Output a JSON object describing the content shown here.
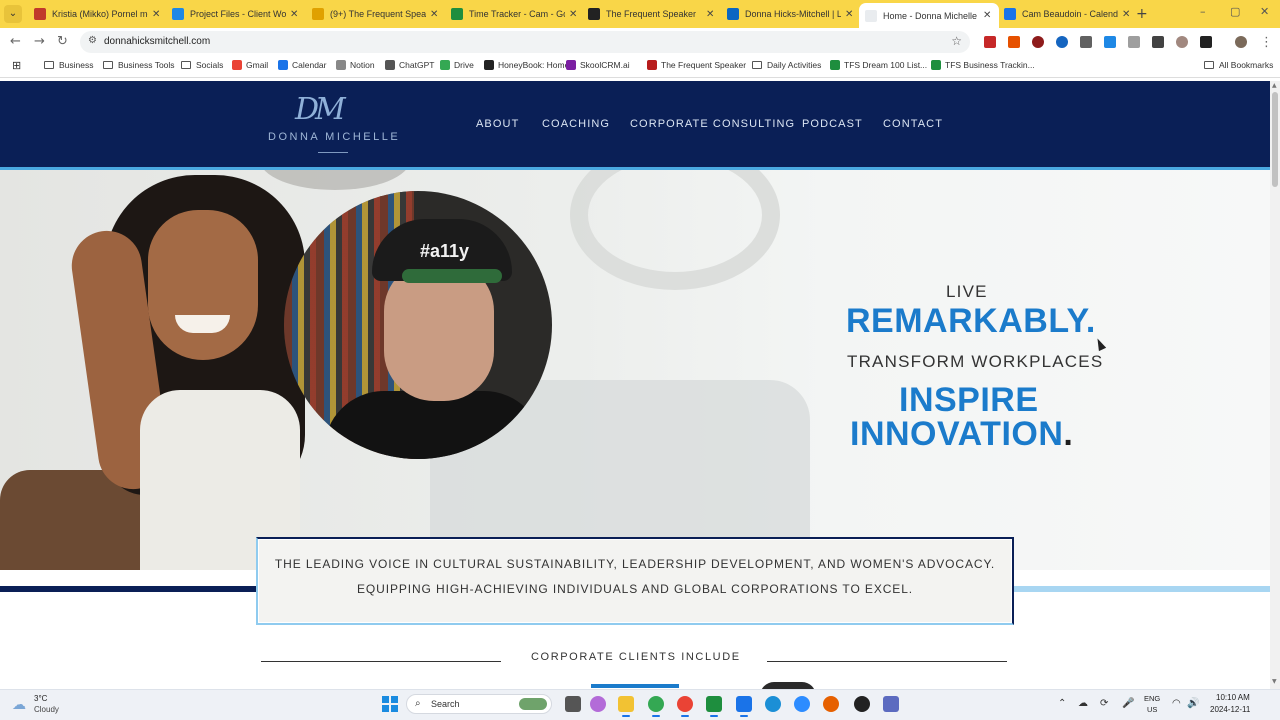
{
  "browser": {
    "tabs": [
      {
        "title": "Kristia (Mikko) Pornel me",
        "color": "#c0392b",
        "active": false
      },
      {
        "title": "Project Files - Client Work",
        "color": "#1e88e5",
        "active": false
      },
      {
        "title": "(9+) The Frequent Speaker",
        "color": "#e0a100",
        "active": false
      },
      {
        "title": "Time Tracker - Cam - Goo",
        "color": "#1e8e3e",
        "active": false
      },
      {
        "title": "The Frequent Speaker",
        "color": "#222222",
        "active": false
      },
      {
        "title": "Donna Hicks-Mitchell | Li",
        "color": "#0a66c2",
        "active": false
      },
      {
        "title": "Home - Donna Michelle",
        "color": "#ffffff",
        "active": true
      },
      {
        "title": "Cam Beaudoin - Calendar",
        "color": "#1a73e8",
        "active": false
      }
    ],
    "url": "donnahicksmitchell.com",
    "bookmarks": [
      {
        "label": "Business",
        "type": "folder"
      },
      {
        "label": "Business Tools",
        "type": "folder"
      },
      {
        "label": "Socials",
        "type": "folder"
      },
      {
        "label": "Gmail",
        "type": "gmail"
      },
      {
        "label": "Calendar",
        "type": "calendar"
      },
      {
        "label": "Notion",
        "type": "notion"
      },
      {
        "label": "ChatGPT",
        "type": "chatgpt"
      },
      {
        "label": "Drive",
        "type": "drive"
      },
      {
        "label": "HoneyBook: Home",
        "type": "honeybook"
      },
      {
        "label": "SkoolCRM.ai",
        "type": "skool"
      },
      {
        "label": "The Frequent Speaker",
        "type": "frequent"
      },
      {
        "label": "Daily Activities",
        "type": "folder"
      },
      {
        "label": "TFS Dream 100 List...",
        "type": "sheets"
      },
      {
        "label": "TFS Business Trackin...",
        "type": "sheets"
      }
    ],
    "all_bookmarks": "All Bookmarks"
  },
  "site": {
    "logo_mark": "DM",
    "logo_text": "DONNA MICHELLE",
    "nav": [
      "ABOUT",
      "COACHING",
      "CORPORATE CONSULTING",
      "PODCAST",
      "CONTACT"
    ],
    "avatar_cap_text": "#a11y",
    "tagline": {
      "live": "LIVE",
      "remarkably": "REMARKABLY",
      "transform": "TRANSFORM WORKPLACES",
      "inspire": "INSPIRE",
      "innovation": "INNOVATION",
      "dot": "."
    },
    "mission": {
      "line1": "THE LEADING VOICE IN CULTURAL SUSTAINABILITY, LEADERSHIP DEVELOPMENT, AND WOMEN'S ADVOCACY.",
      "line2": "EQUIPPING HIGH-ACHIEVING INDIVIDUALS AND GLOBAL CORPORATIONS TO EXCEL."
    },
    "clients_title": "CORPORATE CLIENTS INCLUDE",
    "colors": {
      "navy": "#0a1f56",
      "accent_blue": "#1b7bcb",
      "light_blue": "#a8d6f2"
    }
  },
  "taskbar": {
    "weather_temp": "3°C",
    "weather_cond": "Cloudy",
    "search": "Search",
    "lang": "ENG",
    "region": "US",
    "time": "10:10 AM",
    "date": "2024-12-11"
  }
}
